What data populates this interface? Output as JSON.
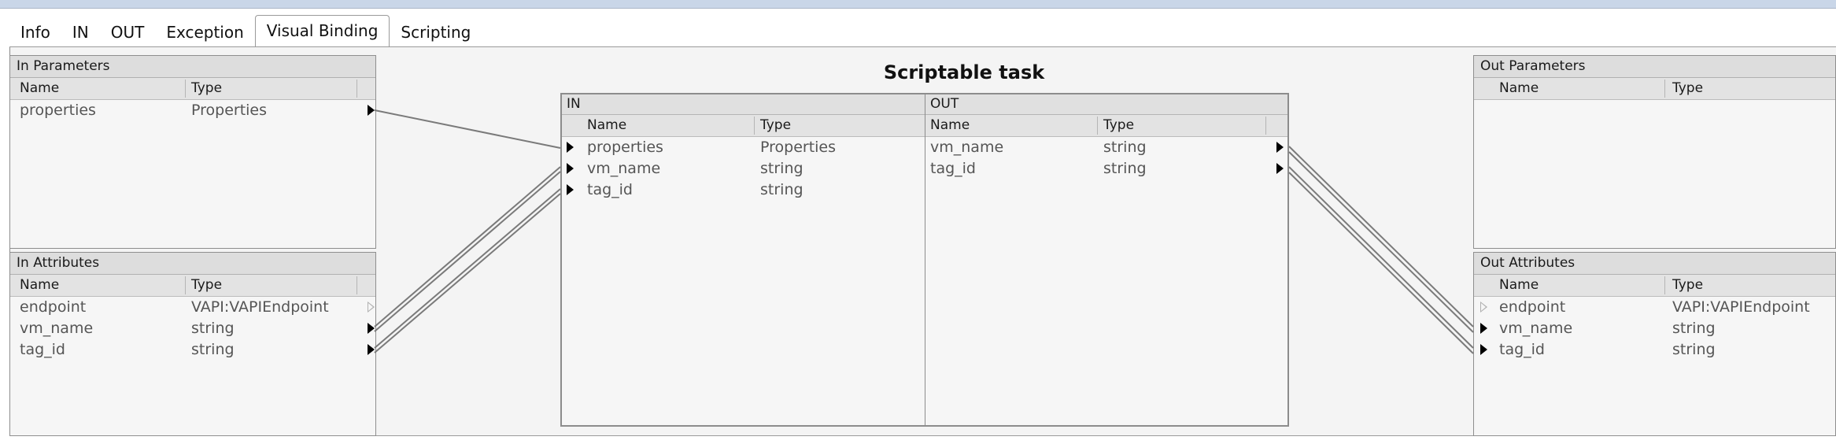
{
  "tabs": [
    "Info",
    "IN",
    "OUT",
    "Exception",
    "Visual Binding",
    "Scripting"
  ],
  "active_tab": "Visual Binding",
  "in_parameters": {
    "title": "In Parameters",
    "col_name": "Name",
    "col_type": "Type",
    "rows": [
      {
        "name": "properties",
        "type": "Properties"
      }
    ]
  },
  "in_attributes": {
    "title": "In Attributes",
    "col_name": "Name",
    "col_type": "Type",
    "rows": [
      {
        "name": "endpoint",
        "type": "VAPI:VAPIEndpoint"
      },
      {
        "name": "vm_name",
        "type": "string"
      },
      {
        "name": "tag_id",
        "type": "string"
      }
    ]
  },
  "task": {
    "title": "Scriptable task",
    "in": {
      "label": "IN",
      "col_name": "Name",
      "col_type": "Type",
      "rows": [
        {
          "name": "properties",
          "type": "Properties"
        },
        {
          "name": "vm_name",
          "type": "string"
        },
        {
          "name": "tag_id",
          "type": "string"
        }
      ]
    },
    "out": {
      "label": "OUT",
      "col_name": "Name",
      "col_type": "Type",
      "rows": [
        {
          "name": "vm_name",
          "type": "string"
        },
        {
          "name": "tag_id",
          "type": "string"
        }
      ]
    }
  },
  "out_parameters": {
    "title": "Out Parameters",
    "col_name": "Name",
    "col_type": "Type",
    "rows": []
  },
  "out_attributes": {
    "title": "Out Attributes",
    "col_name": "Name",
    "col_type": "Type",
    "rows": [
      {
        "name": "endpoint",
        "type": "VAPI:VAPIEndpoint"
      },
      {
        "name": "vm_name",
        "type": "string"
      },
      {
        "name": "tag_id",
        "type": "string"
      }
    ]
  },
  "colors": {
    "panel_bg": "#f6f6f6",
    "header_bg": "#e3e3e3",
    "border": "#8e8e8e",
    "link_line": "#7a7a7a"
  }
}
